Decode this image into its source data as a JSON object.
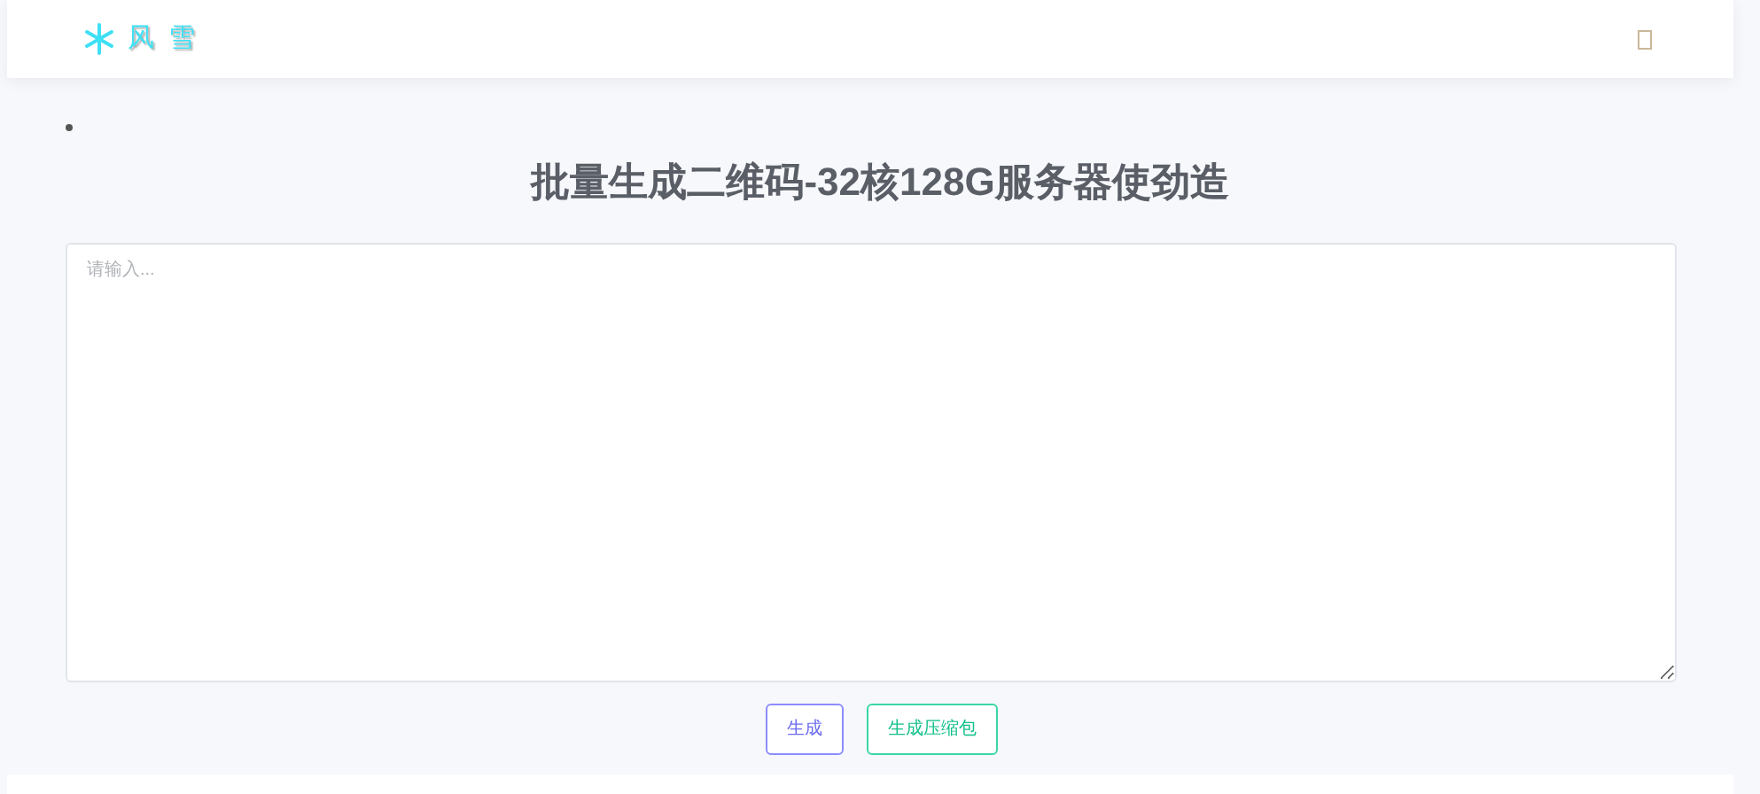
{
  "header": {
    "logo_text": "风 雪"
  },
  "title": "批量生成二维码-32核128G服务器使劲造",
  "input": {
    "placeholder": "请输入..."
  },
  "buttons": [
    {
      "label": "生成",
      "kind": "primary"
    },
    {
      "label": "生成压缩包",
      "kind": "success"
    }
  ]
}
